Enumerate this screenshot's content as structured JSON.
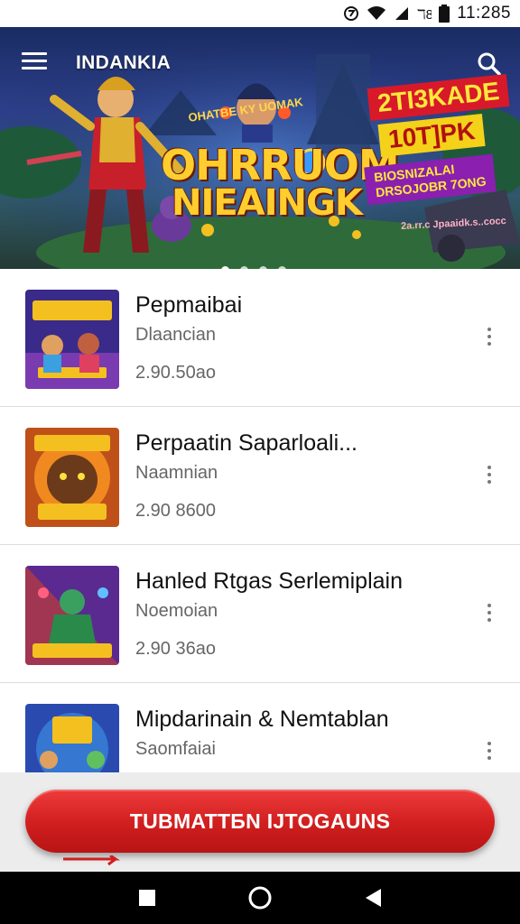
{
  "status_bar": {
    "time": "11:285"
  },
  "header": {
    "title": "INDANKIA"
  },
  "hero": {
    "line1": "OHATBE KY UOMAK",
    "line2": "OHRRUOM",
    "line3": "NIEAINGK",
    "promo1": "2TI3KADE",
    "promo2": "10T]PK",
    "promo3a": "BIOSNIZALAI",
    "promo3b": "DRSOJOBR 7ONG",
    "promo4": "2a.rr.c Jpaaidk.s..cocc",
    "dots": 4,
    "active_dot": 0
  },
  "list": {
    "items": [
      {
        "title": "Pepmaibai",
        "subtitle": "Dlaancian",
        "price": "2.90.50ao"
      },
      {
        "title": "Perpaatin Saparloali...",
        "subtitle": "Naamnian",
        "price": "2.90 8600"
      },
      {
        "title": "Hanled Rtgas Serlemiplain",
        "subtitle": "Noemoian",
        "price": "2.90 36ao"
      },
      {
        "title": "Mipdarinain & Nemtablan",
        "subtitle": "Saomfaiai",
        "price": ""
      }
    ]
  },
  "cta": {
    "label": "TUBMATTБN IJTOGAUNS"
  },
  "colors": {
    "accent": "#d01e1e",
    "hero_bg": "#1a2c63"
  }
}
